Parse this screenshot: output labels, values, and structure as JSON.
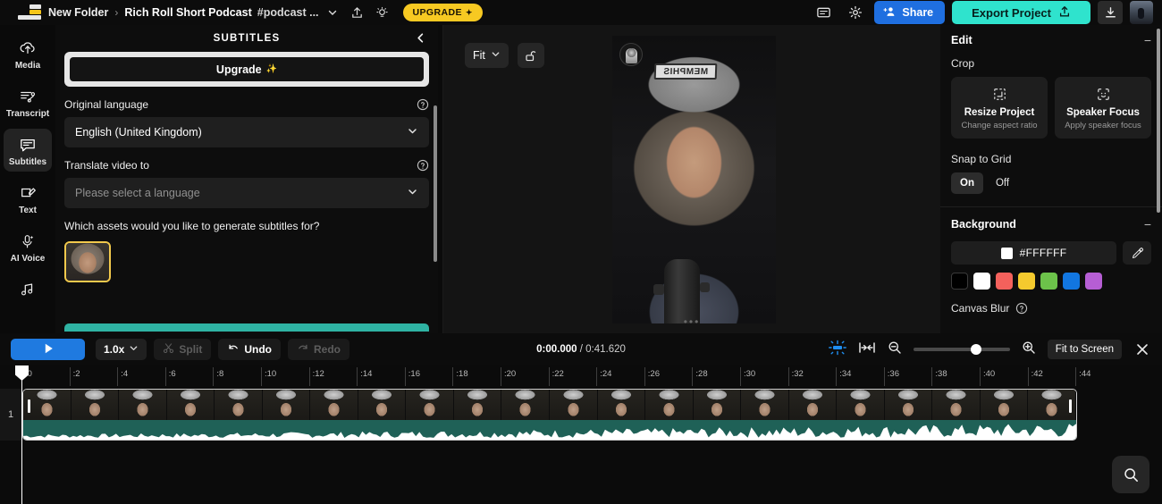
{
  "topbar": {
    "logo": "app-logo",
    "breadcrumb_folder": "New Folder",
    "breadcrumb_sep": "›",
    "project_title": "Rich Roll Short Podcast",
    "project_tags": "#podcast ...",
    "chevron": "⌄",
    "share_icon": "share-upload-icon",
    "idea_icon": "lightbulb-icon",
    "upgrade_label": "UPGRADE",
    "upgrade_sparkle": "✦",
    "comment_icon": "comment-icon",
    "settings_icon": "gear-icon",
    "share_label": "Share",
    "export_label": "Export Project",
    "export_icon": "upload-icon",
    "download_icon": "download-icon",
    "avatar": "user-avatar"
  },
  "rail": {
    "items": [
      {
        "label": "Media",
        "icon": "upload-cloud-icon",
        "active": false
      },
      {
        "label": "Transcript",
        "icon": "transcript-icon",
        "active": false
      },
      {
        "label": "Subtitles",
        "icon": "subtitles-icon",
        "active": true
      },
      {
        "label": "Text",
        "icon": "text-edit-icon",
        "active": false
      },
      {
        "label": "AI Voice",
        "icon": "microphone-ai-icon",
        "active": false
      },
      {
        "label": "",
        "icon": "music-note-icon",
        "active": false
      }
    ]
  },
  "panel": {
    "title": "SUBTITLES",
    "collapse_icon": "chevron-left-icon",
    "upgrade_button": "Upgrade",
    "upgrade_sparkle": "✨",
    "original_language_label": "Original language",
    "original_language_value": "English (United Kingdom)",
    "translate_label": "Translate video to",
    "translate_placeholder": "Please select a language",
    "assets_question": "Which assets would you like to generate subtitles for?",
    "asset_thumb": "video-asset-thumbnail",
    "help_icon": "help-circle-icon",
    "chevron_icon": "chevron-down-icon"
  },
  "stage": {
    "fit_label": "Fit",
    "fit_chevron": "⌄",
    "lock_icon": "unlock-icon",
    "video_cap_text": "MEMPHIS",
    "badge_icon": "channel-logo-icon",
    "grip": "•••"
  },
  "inspector": {
    "edit_title": "Edit",
    "minus": "−",
    "crop_label": "Crop",
    "crop_cards": [
      {
        "title": "Resize Project",
        "desc": "Change aspect ratio",
        "icon": "resize-frame-icon"
      },
      {
        "title": "Speaker Focus",
        "desc": "Apply speaker focus",
        "icon": "face-focus-icon"
      }
    ],
    "snap_label": "Snap to Grid",
    "snap_options": [
      "On",
      "Off"
    ],
    "snap_selected": "On",
    "background_title": "Background",
    "background_hex": "#FFFFFF",
    "eyedropper_icon": "eyedropper-icon",
    "swatches": [
      "#000000",
      "#FFFFFF",
      "#F4615C",
      "#F5CA2E",
      "#6CC24A",
      "#1276E0",
      "#B65ED4"
    ],
    "canvas_blur_label": "Canvas Blur",
    "help_icon": "help-circle-icon"
  },
  "transport": {
    "play_icon": "play-icon",
    "speed_label": "1.0x",
    "speed_chevron": "⌄",
    "split_label": "Split",
    "split_icon": "scissors-icon",
    "undo_label": "Undo",
    "undo_icon": "undo-arrow-icon",
    "redo_label": "Redo",
    "redo_icon": "redo-arrow-icon",
    "current_time": "0:00.000",
    "time_separator": " / ",
    "total_time": "0:41.620",
    "magnet_icon": "snap-magnet-icon",
    "fit_arrows_icon": "fit-selection-icon",
    "zoom_out_icon": "zoom-out-icon",
    "zoom_in_icon": "zoom-in-icon",
    "fit_to_screen_label": "Fit to Screen",
    "close_icon": "close-icon"
  },
  "timeline": {
    "ticks": [
      ":0",
      ":2",
      ":4",
      ":6",
      ":8",
      ":10",
      ":12",
      ":14",
      ":16",
      ":18",
      ":20",
      ":22",
      ":24",
      ":26",
      ":28",
      ":30",
      ":32",
      ":34",
      ":36",
      ":38",
      ":40",
      ":42",
      ":44"
    ],
    "track_number": "1",
    "search_icon": "search-icon"
  }
}
